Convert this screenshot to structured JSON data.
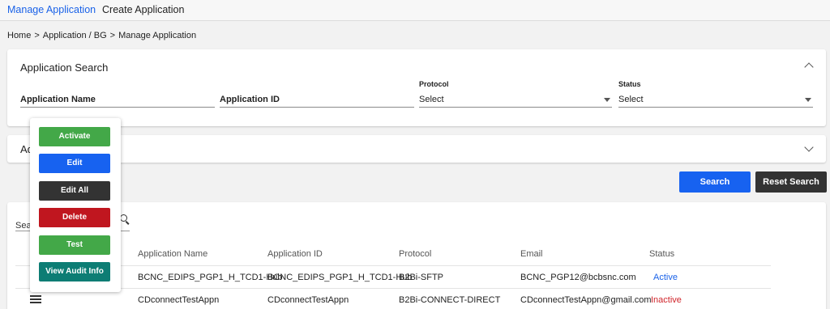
{
  "nav": {
    "tabs": [
      {
        "label": "Manage Application",
        "active": true
      },
      {
        "label": "Create Application",
        "active": false
      }
    ]
  },
  "breadcrumb": {
    "items": [
      "Home",
      "Application / BG",
      "Manage Application"
    ],
    "separator": ">"
  },
  "search_panel": {
    "title": "Application Search",
    "fields": {
      "name": {
        "label": "Application Name"
      },
      "id": {
        "label": "Application ID"
      },
      "protocol": {
        "label": "Protocol",
        "value": "Select"
      },
      "status": {
        "label": "Status",
        "value": "Select"
      }
    }
  },
  "advanced_panel": {
    "title": "Ad"
  },
  "buttons": {
    "search": "Search",
    "reset": "Reset Search"
  },
  "table": {
    "search_placeholder": "Sea",
    "columns": [
      "Application Name",
      "Application ID",
      "Protocol",
      "Email",
      "Status"
    ],
    "rows": [
      {
        "name": "BCNC_EDIPS_PGP1_H_TCD1-Hub",
        "id": "BCNC_EDIPS_PGP1_H_TCD1-Hub",
        "protocol": "B2Bi-SFTP",
        "email": "BCNC_PGP12@bcbsnc.com",
        "status": "Active"
      },
      {
        "name": "CDconnectTestAppn",
        "id": "CDconnectTestAppn",
        "protocol": "B2Bi-CONNECT-DIRECT",
        "email": "CDconnectTestAppn@gmail.com",
        "status": "Inactive"
      }
    ]
  },
  "action_menu": {
    "items": [
      "Activate",
      "Edit",
      "Edit All",
      "Delete",
      "Test",
      "View Audit Info"
    ]
  },
  "colors": {
    "primary": "#1762f0",
    "success": "#43a848",
    "danger": "#c0161f",
    "dark": "#333333",
    "teal": "#0d7d74",
    "active_status": "#1a62e8",
    "inactive_status": "#d0252b"
  }
}
